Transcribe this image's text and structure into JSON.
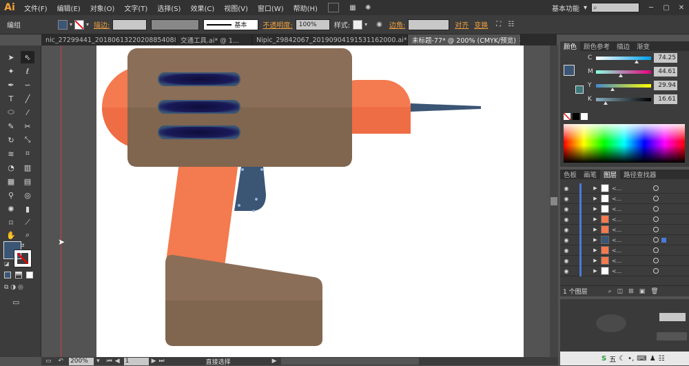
{
  "app": {
    "logo": "Ai",
    "workspace": "基本功能"
  },
  "menu": [
    "文件(F)",
    "编辑(E)",
    "对象(O)",
    "文字(T)",
    "选择(S)",
    "效果(C)",
    "视图(V)",
    "窗口(W)",
    "帮助(H)"
  ],
  "control": {
    "mode": "编组",
    "stroke_label": "描边:",
    "brush_label": "基本",
    "opacity_label": "不透明度:",
    "opacity_value": "100%",
    "style_label": "样式:",
    "corner_label": "边角:",
    "align_label": "对齐",
    "transform_label": "变换"
  },
  "tabs": [
    {
      "label": "nic_27299441_2018061322020885408​8.ai* @ ...",
      "active": false
    },
    {
      "label": "交通工具.ai* @ 1...",
      "active": false
    },
    {
      "label": "Nipic_29842067_20190904191531162000.ai* @...",
      "active": false
    },
    {
      "label": "未标题-77* @ 200% (CMYK/预览)",
      "active": true
    }
  ],
  "status": {
    "zoom": "200%",
    "page": "1",
    "tool": "直接选择"
  },
  "color_panel": {
    "tabs": [
      "颜色",
      "颜色参考",
      "描边",
      "渐变"
    ],
    "channels": [
      {
        "name": "C",
        "value": "74.25",
        "pos": 0.74,
        "grad": "linear-gradient(to right,#fff,#00a0e9)"
      },
      {
        "name": "M",
        "value": "44.61",
        "pos": 0.45,
        "grad": "linear-gradient(to right,#8fd,#e4007f)"
      },
      {
        "name": "Y",
        "value": "29.94",
        "pos": 0.3,
        "grad": "linear-gradient(to right,#48c,#ff0)"
      },
      {
        "name": "K",
        "value": "16.61",
        "pos": 0.17,
        "grad": "linear-gradient(to right,#8ab,#000)"
      }
    ]
  },
  "layers_panel": {
    "tabs": [
      "色板",
      "画笔",
      "图层",
      "路径查找器"
    ],
    "rows": [
      "<...",
      "<...",
      "<...",
      "<...",
      "<...",
      "<...",
      "<...",
      "<...",
      "<..."
    ],
    "thumbs": [
      "#ffffff",
      "#ffffff",
      "#ffffff",
      "#f47a4f",
      "#f47a4f",
      "#3b5575",
      "#f47a4f",
      "#f47a4f",
      "#ffffff"
    ],
    "footer": "1 个图层"
  },
  "colors": {
    "brown": "#8b6e58",
    "brown_dark": "#80664f",
    "orange": "#f47a4f",
    "orange_dark": "#ef6d45",
    "navy": "#3b5575",
    "vent": "#1a1a4a"
  }
}
